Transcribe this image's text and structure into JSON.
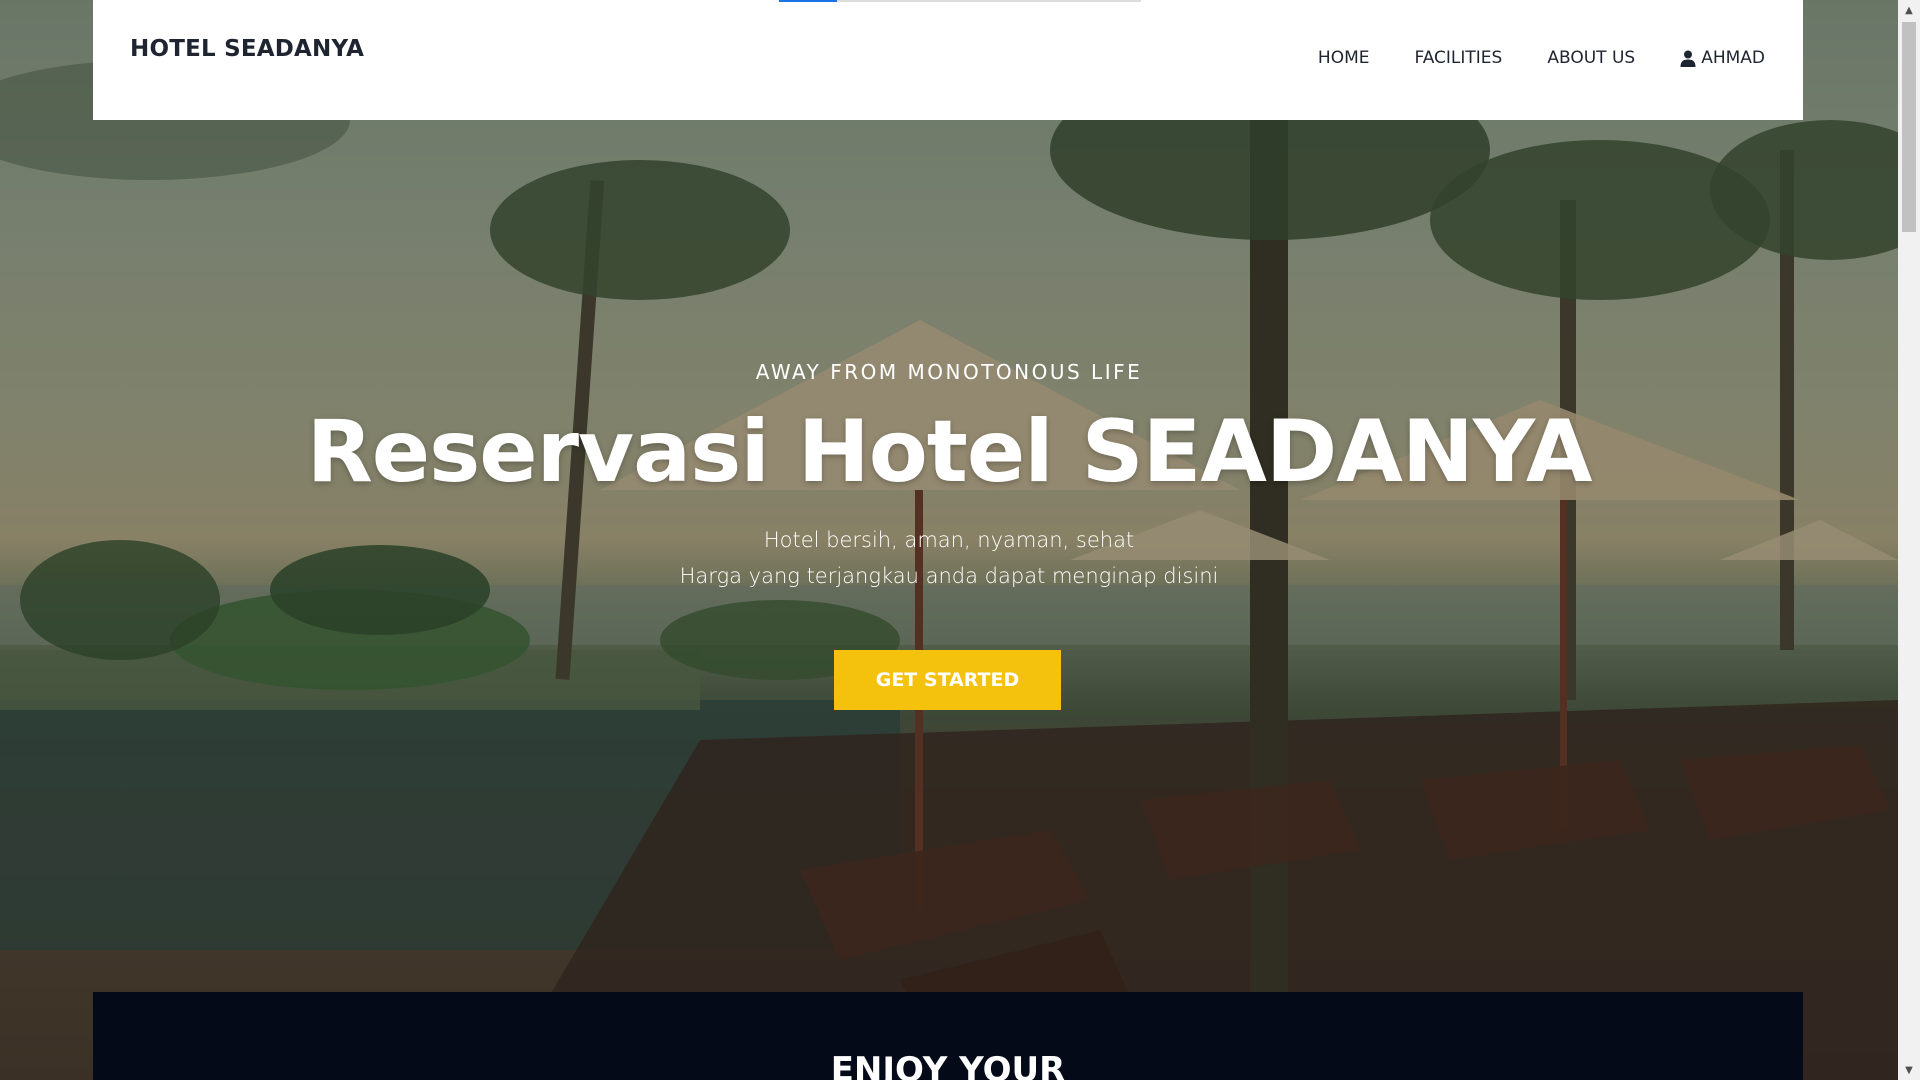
{
  "loading_bar": {
    "progress": 0.16
  },
  "header": {
    "brand": "HOTEL SEADANYA",
    "nav": [
      {
        "label": "HOME"
      },
      {
        "label": "FACILITIES"
      },
      {
        "label": "ABOUT US"
      },
      {
        "label": "AHMAD",
        "icon": "user-icon"
      }
    ]
  },
  "hero": {
    "eyebrow": "AWAY FROM MONOTONOUS LIFE",
    "headline": "Reservasi Hotel SEADANYA",
    "subline_1": "Hotel bersih, aman, nyaman, sehat",
    "subline_2": "Harga yang terjangkau anda dapat menginap disini",
    "cta_label": "GET STARTED",
    "cta_color": "#f4c20d"
  },
  "band": {
    "title": "ENJOY YOUR",
    "color": "#040a18"
  },
  "scrollbar": {
    "icons": [
      "scroll-up-arrow-icon",
      "scroll-down-arrow-icon"
    ]
  }
}
